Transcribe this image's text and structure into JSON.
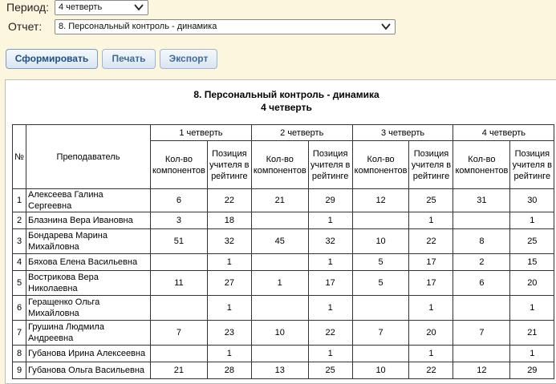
{
  "filters": {
    "period_label": "Период:",
    "period_value": "4 четверть",
    "report_label": "Отчет:",
    "report_value": "8. Персональный контроль - динамика"
  },
  "buttons": {
    "generate": "Сформировать",
    "print": "Печать",
    "export": "Экспорт"
  },
  "report": {
    "title": "8. Персональный контроль - динамика",
    "subtitle": "4 четверть",
    "headers": {
      "num": "№",
      "teacher": "Преподаватель",
      "quarters": [
        "1 четверть",
        "2 четверть",
        "3 четверть",
        "4 четверть"
      ],
      "components": "Кол-во компонентов",
      "position": "Позиция учителя в рейтинге"
    },
    "rows": [
      {
        "n": "1",
        "name": "Алексеева Галина Сергеевна",
        "tall": false,
        "vals": [
          "6",
          "22",
          "21",
          "29",
          "12",
          "25",
          "31",
          "30"
        ]
      },
      {
        "n": "2",
        "name": "Блазнина Вера Ивановна",
        "tall": false,
        "vals": [
          "3",
          "18",
          "",
          "1",
          "",
          "1",
          "",
          "1"
        ]
      },
      {
        "n": "3",
        "name": "Бондарева Марина Михайловна",
        "tall": true,
        "vals": [
          "51",
          "32",
          "45",
          "32",
          "10",
          "22",
          "8",
          "25"
        ]
      },
      {
        "n": "4",
        "name": "Бяхова Елена Васильевна",
        "tall": false,
        "vals": [
          "",
          "1",
          "",
          "1",
          "5",
          "17",
          "2",
          "15"
        ]
      },
      {
        "n": "5",
        "name": "Вострикова Вера Николаевна",
        "tall": true,
        "vals": [
          "11",
          "27",
          "1",
          "17",
          "5",
          "17",
          "6",
          "20"
        ]
      },
      {
        "n": "6",
        "name": "Геращенко Ольга Михайловна",
        "tall": true,
        "vals": [
          "",
          "1",
          "",
          "1",
          "",
          "1",
          "",
          "1"
        ]
      },
      {
        "n": "7",
        "name": "Грушина Людмила Андреевна",
        "tall": true,
        "vals": [
          "7",
          "23",
          "10",
          "22",
          "7",
          "20",
          "7",
          "21"
        ]
      },
      {
        "n": "8",
        "name": "Губанова Ирина Алексеевна",
        "tall": false,
        "vals": [
          "",
          "1",
          "",
          "1",
          "",
          "1",
          "",
          "1"
        ]
      },
      {
        "n": "9",
        "name": "Губанова Ольга Васильевна",
        "tall": false,
        "vals": [
          "21",
          "28",
          "13",
          "25",
          "10",
          "22",
          "12",
          "29"
        ]
      }
    ]
  },
  "colors": {
    "page_bg": "#fdf6df",
    "button_text": "#3f6b9a"
  }
}
